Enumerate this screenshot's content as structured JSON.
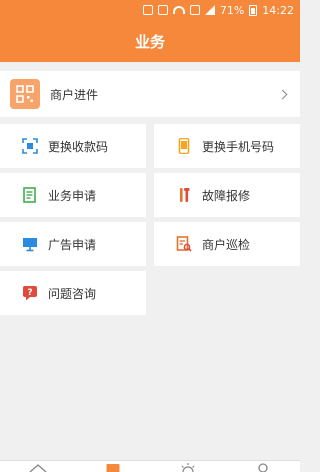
{
  "status_bar": {
    "battery": "71%",
    "time": "14:22"
  },
  "header": {
    "title": "业务"
  },
  "merchant": {
    "label": "商户进件"
  },
  "grid": [
    [
      {
        "label": "更换收款码",
        "icon": "scan-code-icon"
      },
      {
        "label": "更换手机号码",
        "icon": "phone-icon"
      }
    ],
    [
      {
        "label": "业务申请",
        "icon": "form-icon"
      },
      {
        "label": "故障报修",
        "icon": "repair-tools-icon"
      }
    ],
    [
      {
        "label": "广告申请",
        "icon": "ad-screen-icon"
      },
      {
        "label": "商户巡检",
        "icon": "inspection-icon"
      }
    ],
    [
      {
        "label": "问题咨询",
        "icon": "question-icon"
      }
    ]
  ],
  "colors": {
    "primary": "#f5883a",
    "blue": "#2a8be0",
    "red": "#e04b3c"
  }
}
